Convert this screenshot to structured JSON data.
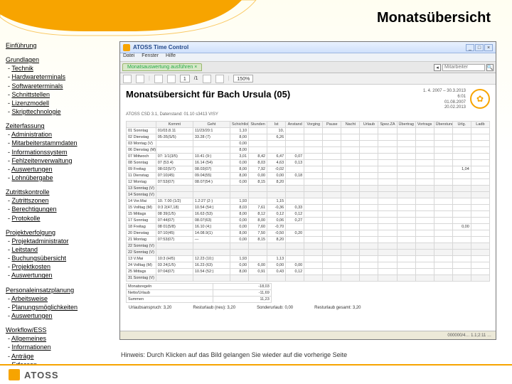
{
  "title": "Monatsübersicht",
  "nav": [
    {
      "head": "Einführung",
      "items": []
    },
    {
      "head": "Grundlagen",
      "items": [
        "Technik",
        "Hardwareterminals",
        "Softwareterminals",
        "Schnittstellen",
        "Lizenzmodell",
        "Skripttechnologie"
      ]
    },
    {
      "head": "Zeiterfassung",
      "items": [
        "Administration",
        "Mitarbeiterstammdaten",
        "Informationssystem",
        "Fehlzeitenverwaltung",
        "Auswertungen",
        "Lohnübergabe"
      ]
    },
    {
      "head": "Zutrittskontrolle",
      "items": [
        "Zutrittszonen",
        "Berechtigungen",
        "Protokolle"
      ]
    },
    {
      "head": "Projektverfolgung",
      "items": [
        "Projektadministrator",
        "Leitstand",
        "Buchungsübersicht",
        "Projektkosten",
        "Auswertungen"
      ]
    },
    {
      "head": "Personaleinsatzplanung",
      "items": [
        "Arbeitsweise",
        "Planungsmöglichkeiten",
        "Auswertungen"
      ]
    },
    {
      "head": "Workflow/ESS",
      "items": [
        "Allgemeines",
        "Informationen",
        "Anträge",
        "Erfassen"
      ]
    }
  ],
  "app": {
    "winTitle": "ATOSS Time Control",
    "menu": [
      "Datei",
      "Fenster",
      "Hilfe"
    ],
    "tab": "Monatsauswertung ausführen",
    "search_placeholder": "Mitarbeiter",
    "page_num": "1",
    "page_of": "/1",
    "zoom": "150%"
  },
  "report": {
    "heading": "Monatsübersicht für Bach Ursula (05)",
    "sub": "ATOSS CSD 3.1,  Datenstand: 01.10  s3413 VISY",
    "meta_lines": [
      "1. 4. 2007 – 30.3.2013",
      "6:01",
      "01.08.2007",
      "20.02.2013"
    ],
    "cols": [
      "",
      "Kommt",
      "Geht",
      "Schichtlohn",
      "Stunden",
      "Ist",
      "Anstand",
      "Vorging",
      "Pause",
      "Nacht",
      "Urlaub",
      "Spez.ZA",
      "Übertrag",
      "Vortrags",
      "Überstunden",
      "Urlg.",
      "Ladb"
    ],
    "rows": [
      {
        "d": "01",
        "w": "Sonntag",
        "dt": "01/03.8.11",
        "t2": "11/23/20:1",
        "v": [
          "1,10",
          "",
          "10,",
          "",
          "",
          "",
          "",
          "",
          "",
          "",
          "",
          "",
          "",
          ""
        ]
      },
      {
        "d": "02",
        "w": "Dienstag",
        "dt": "05-35(S/5)",
        "t2": "33.28 (7)",
        "v": [
          "8,00",
          "",
          "6,26",
          "",
          "",
          "",
          "",
          "",
          "",
          "",
          "",
          "",
          "",
          ""
        ]
      },
      {
        "d": "03",
        "w": "Montag (V)",
        "dt": "",
        "t2": "",
        "v": [
          "0,00",
          "",
          "",
          "",
          "",
          "",
          "",
          "",
          "",
          "",
          "",
          "",
          "",
          ""
        ]
      },
      {
        "d": "06",
        "w": "Dienstag (M)",
        "dt": "",
        "t2": "",
        "v": [
          "8,00",
          "",
          "",
          "",
          "",
          "",
          "",
          "",
          "",
          "",
          "",
          "",
          "",
          ""
        ]
      },
      {
        "d": "07",
        "w": "Mittwoch",
        "dt": "07: 1/1(3/5)",
        "t2": "10.41 (9:)",
        "v": [
          "3,01",
          "8,42",
          "6,47",
          "0,07",
          "",
          "",
          "",
          "",
          "",
          "",
          "",
          "",
          "",
          ""
        ]
      },
      {
        "d": "08",
        "w": "Sonntag",
        "dt": "07 (53.4)",
        "t2": "16.14 (54)",
        "v": [
          "0,00",
          "8,03",
          "4,63",
          "0,13",
          "",
          "",
          "",
          "",
          "",
          "",
          "",
          "",
          "",
          ""
        ]
      },
      {
        "d": "09",
        "w": "Freitag",
        "dt": "08:02(5/7)",
        "t2": "08.03(07)",
        "v": [
          "8,00",
          "7,92",
          "-0,02",
          "",
          "",
          "",
          "",
          "",
          "",
          "",
          "",
          "",
          "1,04",
          ""
        ]
      },
      {
        "d": "11",
        "w": "Dienstag",
        "dt": "07:10(45)",
        "t2": "09.04(55)",
        "v": [
          "8,00",
          "0,00",
          "0,00",
          "0,18",
          "",
          "",
          "",
          "",
          "",
          "",
          "",
          "",
          "",
          ""
        ]
      },
      {
        "d": "12",
        "w": "Montag",
        "dt": "07:53(07)",
        "t2": "08.07(54:)",
        "v": [
          "0,00",
          "8,15",
          "8,20",
          "",
          "",
          "",
          "",
          "",
          "",
          "",
          "",
          "",
          "",
          ""
        ]
      },
      {
        "d": "13",
        "w": "Sonntag (V)",
        "dt": "",
        "t2": "",
        "v": [
          "",
          "",
          "",
          "",
          "",
          "",
          "",
          "",
          "",
          "",
          "",
          "",
          "",
          ""
        ],
        "sun": true
      },
      {
        "d": "14",
        "w": "Sonntag (V)",
        "dt": "",
        "t2": "",
        "v": [
          "",
          "",
          "",
          "",
          "",
          "",
          "",
          "",
          "",
          "",
          "",
          "",
          "",
          ""
        ],
        "sun": true
      },
      {
        "d": "14",
        "w": "Vor.Mai",
        "dt": "10. 7.00 (1/2)",
        "t2": "1.2:27 (2·)",
        "v": [
          "1,93",
          "",
          "1,15",
          "",
          "",
          "",
          "",
          "",
          "",
          "",
          "",
          "",
          "",
          ""
        ]
      },
      {
        "d": "15",
        "w": "Volltag (M)",
        "dt": "0:3 2(47,18)",
        "t2": "10.54 (54:)",
        "v": [
          "8,03",
          "7,61",
          "-0,36",
          "0,33",
          "",
          "",
          "",
          "",
          "",
          "",
          "",
          "",
          "",
          ""
        ]
      },
      {
        "d": "15",
        "w": "Mittags",
        "dt": "08 39(1/5)",
        "t2": "16.63 (53)",
        "v": [
          "8,00",
          "8,12",
          "0,12",
          "0,12",
          "",
          "",
          "",
          "",
          "",
          "",
          "",
          "",
          "",
          ""
        ]
      },
      {
        "d": "17",
        "w": "Sonntag",
        "dt": "07:44(07)",
        "t2": "08.07(63)",
        "v": [
          "0,00",
          "8,00",
          "0,06",
          "0,27",
          "",
          "",
          "",
          "",
          "",
          "",
          "",
          "",
          "",
          ""
        ]
      },
      {
        "d": "18",
        "w": "Freitag",
        "dt": "08 01(5/8)",
        "t2": "16.10 (4;)",
        "v": [
          "0,00",
          "7,60",
          "-0,70",
          "",
          "",
          "",
          "",
          "",
          "",
          "",
          "",
          "",
          "0,00",
          ""
        ]
      },
      {
        "d": "20",
        "w": "Dienstag",
        "dt": "07:10(45)",
        "t2": "14.08.9(1)",
        "v": [
          "8,00",
          "7,50",
          "-0,50",
          "0,20",
          "",
          "",
          "",
          "",
          "",
          "",
          "",
          "",
          "",
          ""
        ]
      },
      {
        "d": "21",
        "w": "Montag",
        "dt": "07:53(07)",
        "t2": "—",
        "v": [
          "0,00",
          "8,15",
          "8,20",
          "",
          "",
          "",
          "",
          "",
          "",
          "",
          "",
          "",
          "",
          ""
        ]
      },
      {
        "d": "22",
        "w": "Sonntag (V)",
        "dt": "",
        "t2": "",
        "v": [
          "",
          "",
          "",
          "",
          "",
          "",
          "",
          "",
          "",
          "",
          "",
          "",
          "",
          ""
        ],
        "sun": true
      },
      {
        "d": "22",
        "w": "Sonntag (V)",
        "dt": "",
        "t2": "",
        "v": [
          "",
          "",
          "",
          "",
          "",
          "",
          "",
          "",
          "",
          "",
          "",
          "",
          "",
          ""
        ],
        "sun": true
      },
      {
        "d": "13",
        "w": "V.Mai",
        "dt": "10:3 (H/5)",
        "t2": "12.23 (10;)",
        "v": [
          "1,93",
          "",
          "1,13",
          "",
          "",
          "",
          "",
          "",
          "",
          "",
          "",
          "",
          "",
          ""
        ]
      },
      {
        "d": "24",
        "w": "Volltag (M)",
        "dt": "03 24(1/5)",
        "t2": "16.23 (63)",
        "v": [
          "0,00",
          "6,00",
          "0,00",
          "0,00",
          "",
          "",
          "",
          "",
          "",
          "",
          "",
          "",
          "",
          ""
        ]
      },
      {
        "d": "25",
        "w": "Mittags",
        "dt": "07:04(07)",
        "t2": "10.54 (52:)",
        "v": [
          "8,00",
          "0,91",
          "0,43",
          "0,12",
          "",
          "",
          "",
          "",
          "",
          "",
          "",
          "",
          "",
          ""
        ]
      },
      {
        "d": "31",
        "w": "Sonntag (V)",
        "dt": "",
        "t2": "",
        "v": [
          "",
          "",
          "",
          "",
          "",
          "",
          "",
          "",
          "",
          "",
          "",
          "",
          "",
          ""
        ],
        "sun": true
      }
    ],
    "totals_rows": [
      {
        "l1": "Monatsregeln",
        "l2": "",
        "v": "-18,03"
      },
      {
        "l1": "Netto/Urlaub",
        "l2": "",
        "v": "-11,69"
      },
      {
        "l1": "Summen",
        "l2": "",
        "v": "11,23"
      }
    ],
    "bottom": [
      "Urlaubsanspruch:  3,20",
      "Resturlaub (neu):  3,20",
      "Sonderurlaub:  0,00",
      "Resturlaub gesamt:  3,20"
    ],
    "status": "000000/4…  1.1;2:11 …"
  },
  "hint": "Hinweis: Durch Klicken auf das Bild gelangen Sie wieder auf die vorherige Seite",
  "brand": "ATOSS"
}
